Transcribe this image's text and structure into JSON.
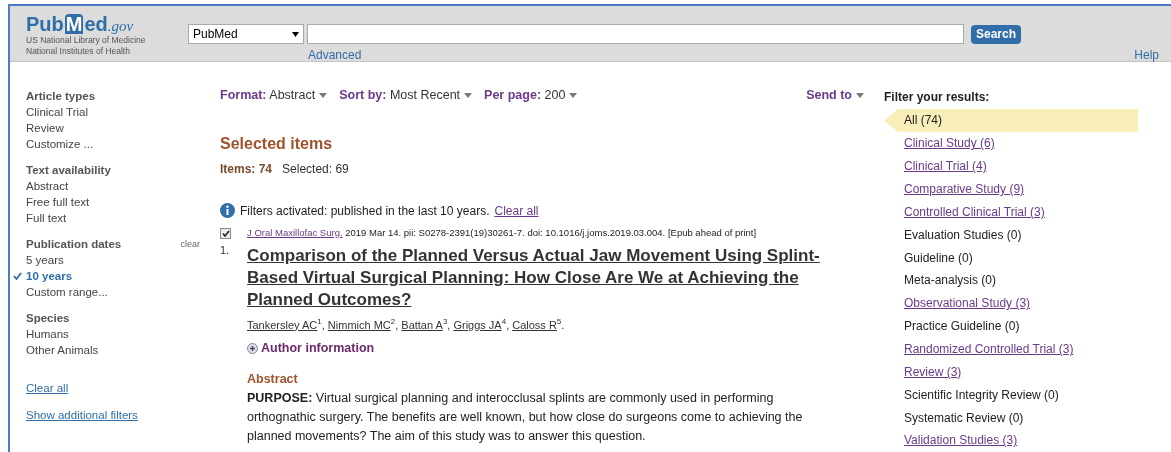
{
  "header": {
    "logo": {
      "pub": "Pub",
      "med": "Med",
      "gov": ".gov"
    },
    "org_lines": [
      "US National Library of Medicine",
      "National Institutes of Health"
    ],
    "database": "PubMed",
    "search_button": "Search",
    "advanced": "Advanced",
    "help": "Help"
  },
  "sidebar": {
    "sections": [
      {
        "title": "Article types",
        "items": [
          {
            "label": "Clinical Trial",
            "selected": false
          },
          {
            "label": "Review",
            "selected": false
          },
          {
            "label": "Customize ...",
            "selected": false
          }
        ]
      },
      {
        "title": "Text availability",
        "items": [
          {
            "label": "Abstract",
            "selected": false
          },
          {
            "label": "Free full text",
            "selected": false
          },
          {
            "label": "Full text",
            "selected": false
          }
        ]
      },
      {
        "title": "Publication dates",
        "clear": "clear",
        "items": [
          {
            "label": "5 years",
            "selected": false
          },
          {
            "label": "10 years",
            "selected": true
          },
          {
            "label": "Custom range...",
            "selected": false
          }
        ]
      },
      {
        "title": "Species",
        "items": [
          {
            "label": "Humans",
            "selected": false
          },
          {
            "label": "Other Animals",
            "selected": false
          }
        ]
      }
    ],
    "links": [
      "Clear all",
      "Show additional filters"
    ]
  },
  "toolbar": {
    "controls": [
      {
        "label": "Format:",
        "value": "Abstract"
      },
      {
        "label": "Sort by:",
        "value": "Most Recent"
      },
      {
        "label": "Per page:",
        "value": "200"
      }
    ],
    "send_to": "Send to"
  },
  "selection": {
    "title": "Selected items",
    "items_label": "Items: 74",
    "selected_label": "Selected: 69"
  },
  "filter_notice": {
    "text": "Filters activated: published in the last 10 years.",
    "link": "Clear all"
  },
  "result": {
    "checked": true,
    "number": "1.",
    "journal": "J Oral Maxillofac Surg.",
    "citation": "2019 Mar 14. pii: S0278-2391(19)30261-7. doi: 10.1016/j.joms.2019.03.004. [Epub ahead of print]",
    "title": "Comparison of the Planned Versus Actual Jaw Movement Using Splint-Based Virtual Surgical Planning: How Close Are We at Achieving the Planned Outcomes?",
    "authors": [
      {
        "name": "Tankersley AC",
        "sup": "1",
        "sep": ","
      },
      {
        "name": "Nimmich MC",
        "sup": "2",
        "sep": ","
      },
      {
        "name": "Battan A",
        "sup": "3",
        "sep": ","
      },
      {
        "name": "Griggs JA",
        "sup": "4",
        "sep": ","
      },
      {
        "name": "Caloss R",
        "sup": "5",
        "sep": "."
      }
    ],
    "author_info": "Author information",
    "abstract_heading": "Abstract",
    "abstract": "**PURPOSE:** Virtual surgical planning and interocclusal splints are commonly used in performing orthognathic surgery. The benefits are well known, but how close do surgeons come to achieving the planned movements? The aim of this study was to answer this question."
  },
  "filters": {
    "title": "Filter your results:",
    "items": [
      {
        "label": "All (74)",
        "kind": "plain",
        "selected": true
      },
      {
        "label": "Clinical Study (6)",
        "kind": "link",
        "selected": false
      },
      {
        "label": "Clinical Trial (4)",
        "kind": "link",
        "selected": false
      },
      {
        "label": "Comparative Study (9)",
        "kind": "link",
        "selected": false
      },
      {
        "label": "Controlled Clinical Trial (3)",
        "kind": "link",
        "selected": false
      },
      {
        "label": "Evaluation Studies (0)",
        "kind": "plain",
        "selected": false
      },
      {
        "label": "Guideline (0)",
        "kind": "plain",
        "selected": false
      },
      {
        "label": "Meta-analysis (0)",
        "kind": "plain",
        "selected": false
      },
      {
        "label": "Observational Study (3)",
        "kind": "link",
        "selected": false
      },
      {
        "label": "Practice Guideline (0)",
        "kind": "plain",
        "selected": false
      },
      {
        "label": "Randomized Controlled Trial (3)",
        "kind": "link",
        "selected": false
      },
      {
        "label": "Review (3)",
        "kind": "link",
        "selected": false
      },
      {
        "label": "Scientific Integrity Review (0)",
        "kind": "plain",
        "selected": false
      },
      {
        "label": "Systematic Review (0)",
        "kind": "plain",
        "selected": false
      },
      {
        "label": "Validation Studies (3)",
        "kind": "link",
        "selected": false
      }
    ]
  }
}
